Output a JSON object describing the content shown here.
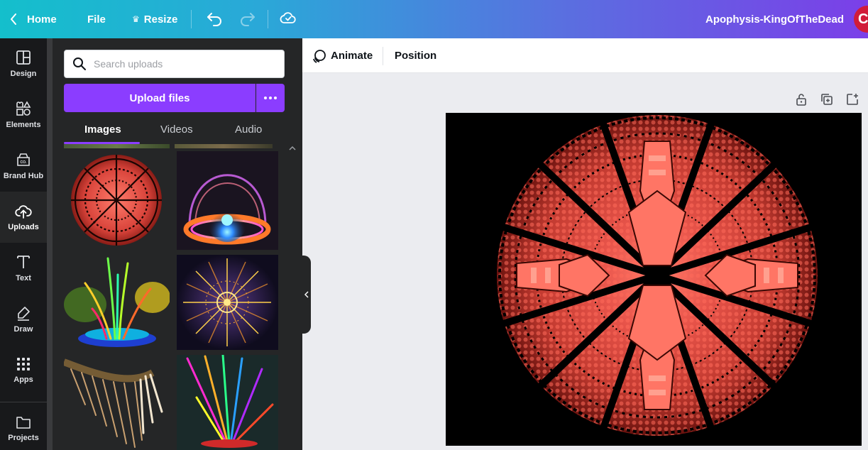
{
  "topbar": {
    "home_label": "Home",
    "file_label": "File",
    "resize_label": "Resize",
    "document_name": "Apophysis-KingOfTheDead",
    "avatar_initial": "C"
  },
  "rail": {
    "items": [
      {
        "label": "Design",
        "icon": "design-icon"
      },
      {
        "label": "Elements",
        "icon": "elements-icon"
      },
      {
        "label": "Brand Hub",
        "icon": "brand-hub-icon"
      },
      {
        "label": "Uploads",
        "icon": "upload-cloud-icon"
      },
      {
        "label": "Text",
        "icon": "text-icon"
      },
      {
        "label": "Draw",
        "icon": "draw-icon"
      },
      {
        "label": "Apps",
        "icon": "apps-icon"
      },
      {
        "label": "Projects",
        "icon": "folder-icon"
      }
    ],
    "active": "Uploads"
  },
  "uploads_panel": {
    "search_placeholder": "Search uploads",
    "upload_button_label": "Upload files",
    "tabs": [
      {
        "label": "Images",
        "active": true
      },
      {
        "label": "Videos",
        "active": false
      },
      {
        "label": "Audio",
        "active": false
      }
    ],
    "thumbnails": [
      "red-circular-fractal",
      "glowing-orb-dome",
      "rainbow-grass-fractal",
      "golden-kaleidoscope-fractal",
      "feather-fractal",
      "neon-rays-fractal"
    ]
  },
  "context_toolbar": {
    "animate_label": "Animate",
    "position_label": "Position"
  },
  "colors": {
    "accent": "#8b3dff",
    "fractal": "#f0574c"
  }
}
